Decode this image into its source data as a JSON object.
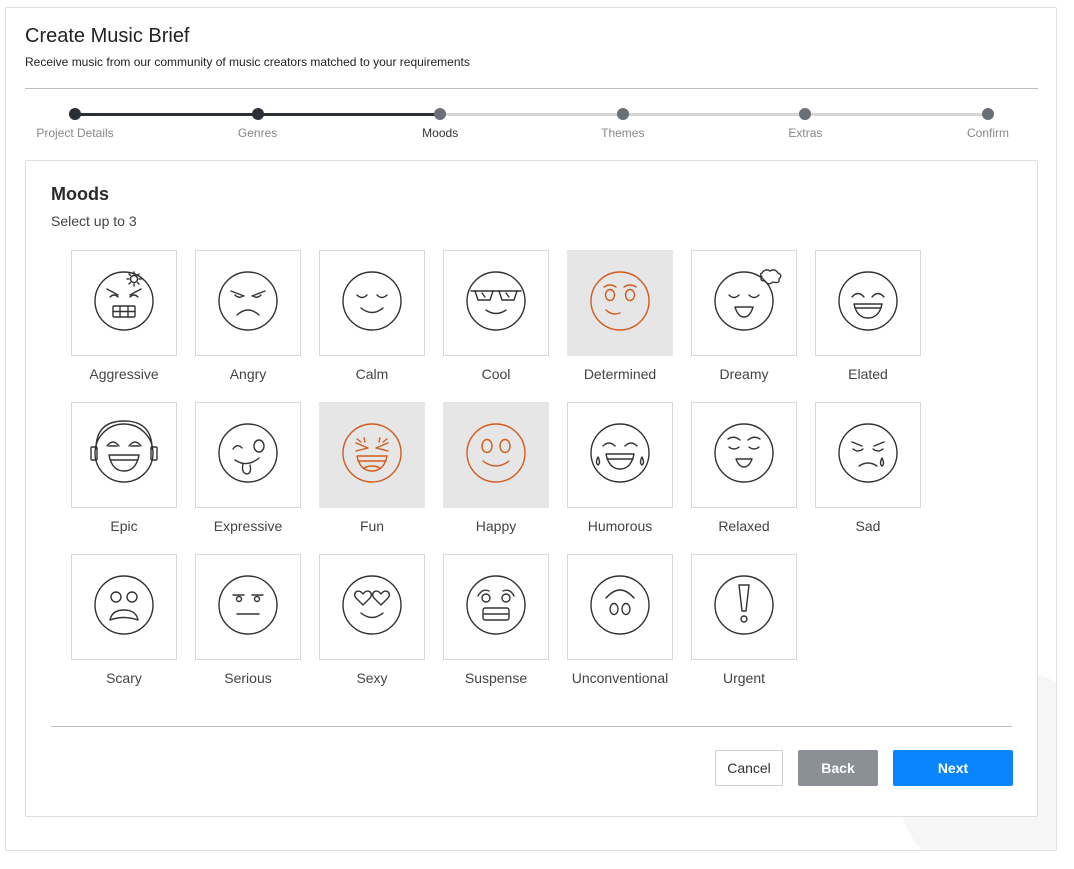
{
  "header": {
    "title": "Create Music Brief",
    "subtitle": "Receive music from our community of music creators matched to your requirements"
  },
  "steps": [
    {
      "label": "Project Details",
      "status": "done"
    },
    {
      "label": "Genres",
      "status": "done"
    },
    {
      "label": "Moods",
      "status": "current"
    },
    {
      "label": "Themes",
      "status": "todo"
    },
    {
      "label": "Extras",
      "status": "todo"
    },
    {
      "label": "Confirm",
      "status": "todo"
    }
  ],
  "panel": {
    "title": "Moods",
    "subtitle": "Select up to 3"
  },
  "moods": [
    {
      "label": "Aggressive",
      "icon": "aggressive-face-icon",
      "selected": false
    },
    {
      "label": "Angry",
      "icon": "angry-face-icon",
      "selected": false
    },
    {
      "label": "Calm",
      "icon": "calm-face-icon",
      "selected": false
    },
    {
      "label": "Cool",
      "icon": "cool-face-icon",
      "selected": false
    },
    {
      "label": "Determined",
      "icon": "determined-face-icon",
      "selected": true
    },
    {
      "label": "Dreamy",
      "icon": "dreamy-face-icon",
      "selected": false
    },
    {
      "label": "Elated",
      "icon": "elated-face-icon",
      "selected": false
    },
    {
      "label": "Epic",
      "icon": "epic-face-icon",
      "selected": false
    },
    {
      "label": "Expressive",
      "icon": "expressive-face-icon",
      "selected": false
    },
    {
      "label": "Fun",
      "icon": "fun-face-icon",
      "selected": true
    },
    {
      "label": "Happy",
      "icon": "happy-face-icon",
      "selected": true
    },
    {
      "label": "Humorous",
      "icon": "humorous-face-icon",
      "selected": false
    },
    {
      "label": "Relaxed",
      "icon": "relaxed-face-icon",
      "selected": false
    },
    {
      "label": "Sad",
      "icon": "sad-face-icon",
      "selected": false
    },
    {
      "label": "Scary",
      "icon": "scary-face-icon",
      "selected": false
    },
    {
      "label": "Serious",
      "icon": "serious-face-icon",
      "selected": false
    },
    {
      "label": "Sexy",
      "icon": "sexy-face-icon",
      "selected": false
    },
    {
      "label": "Suspense",
      "icon": "suspense-face-icon",
      "selected": false
    },
    {
      "label": "Unconventional",
      "icon": "unconventional-face-icon",
      "selected": false
    },
    {
      "label": "Urgent",
      "icon": "urgent-face-icon",
      "selected": false
    }
  ],
  "buttons": {
    "cancel": "Cancel",
    "back": "Back",
    "next": "Next"
  },
  "colors": {
    "accent_selected": "#d35a1a",
    "primary_button": "#0a84ff",
    "secondary_button": "#8b9097",
    "progress_done": "#2b2f36"
  }
}
